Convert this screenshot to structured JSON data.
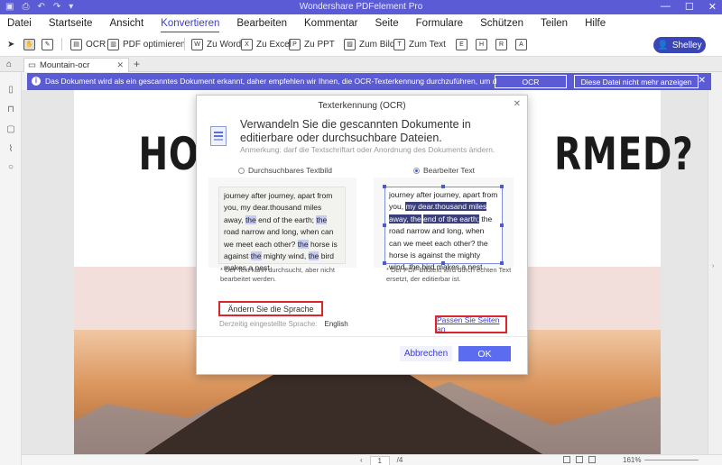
{
  "app": {
    "title": "Wondershare PDFelement Pro",
    "quick_access_icons": [
      "save-icon",
      "print-icon",
      "undo-icon",
      "redo-icon",
      "dropdown-icon"
    ],
    "window_controls": [
      "minimize-icon",
      "maximize-icon",
      "close-icon"
    ]
  },
  "menu": [
    "Datei",
    "Startseite",
    "Ansicht",
    "Konvertieren",
    "Bearbeiten",
    "Kommentar",
    "Seite",
    "Formulare",
    "Schützen",
    "Teilen",
    "Hilfe"
  ],
  "menu_active": "Konvertieren",
  "toolbar": {
    "ocr": "OCR",
    "optimize": "PDF optimieren",
    "to_word": "Zu Word",
    "to_excel": "Zu Excel",
    "to_ppt": "Zu PPT",
    "to_image": "Zum Bild",
    "to_text": "Zum Text",
    "user": "Shelley"
  },
  "tab": {
    "name": "Mountain-ocr"
  },
  "notification": {
    "message": "Das Dokument wird als ein gescanntes Dokument erkannt, daher empfehlen wir Ihnen, die OCR-Texterkennung durchzuführen, um die Texte aus PDF...",
    "ocr_button": "OCR",
    "dismiss_button": "Diese Datei nicht mehr anzeigen"
  },
  "document": {
    "headline_left": "HOW A",
    "headline_right": "RMED?",
    "page_current": "1",
    "page_total": "/4",
    "zoom": "161%"
  },
  "dialog": {
    "title": "Texterkennung (OCR)",
    "heading": "Verwandeln Sie die gescannten Dokumente in editierbare oder durchsuchbare Dateien.",
    "note": "Anmerkung: darf die Textschriftart oder Anordnung des Dokuments ändern.",
    "option_searchable": "Durchsuchbares Textbild",
    "option_editable": "Bearbeiter Text",
    "sample_text": "journey after journey, apart from you, my dear.thousand miles away, the end of the earth; the road narrow and long, when can we meet each other? the horse is against the mighty wind, the bird makes a nest",
    "caption_searchable": "* Der Text kann durchsucht, aber nicht bearbeitet werden.",
    "caption_editable": "* Der PDF-Bildtext wird durch echten Text ersetzt, der editierbar ist.",
    "change_language": "Ändern Sie die Sprache",
    "current_language_label": "Derzeitig eingestellte Sprache:",
    "current_language_value": "English",
    "customize_pages": "Passen Sie Seiten an",
    "cancel": "Abbrechen",
    "ok": "OK"
  },
  "colors": {
    "accent": "#5b5bd6",
    "highlight_red": "#d9262c",
    "ok_button": "#5b6cf0"
  }
}
